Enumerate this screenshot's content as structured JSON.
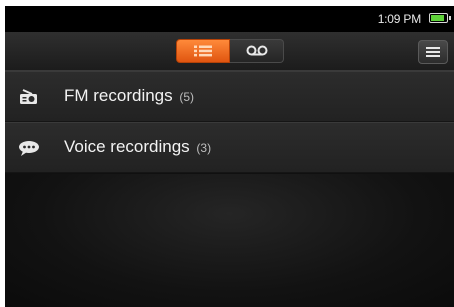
{
  "status_bar": {
    "time": "1:09 PM",
    "battery_icon": "battery-icon",
    "battery_level": 0.85,
    "battery_color": "#5fd23a"
  },
  "top_bar": {
    "segments": [
      {
        "icon": "list-icon",
        "selected": true,
        "color": "#f06a20"
      },
      {
        "icon": "voicemail-icon",
        "selected": false
      }
    ],
    "menu_icon": "menu-icon"
  },
  "list": {
    "items": [
      {
        "icon": "radio-icon",
        "label": "FM recordings",
        "count": "(5)"
      },
      {
        "icon": "speech-bubble-icon",
        "label": "Voice recordings",
        "count": "(3)"
      }
    ]
  }
}
